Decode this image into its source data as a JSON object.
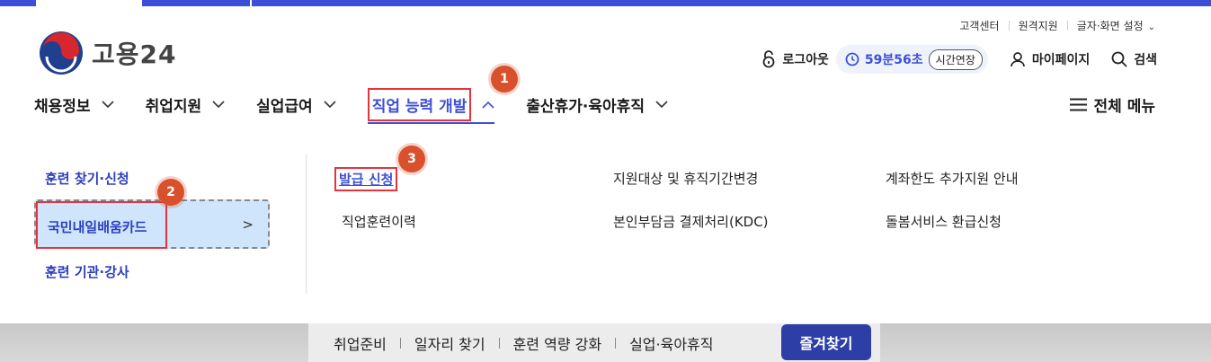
{
  "colors": {
    "brand": "#3d4fd6",
    "highlight_red": "#e5333c",
    "badge": "#d8512c",
    "fav_button": "#2d3fa6"
  },
  "util_links": [
    "고객센터",
    "원격지원",
    "글자·화면 설정"
  ],
  "logo": {
    "name": "고용24"
  },
  "account": {
    "logout": "로그아웃",
    "timer": "59분56초",
    "extend": "시간연장",
    "mypage": "마이페이지",
    "search": "검색"
  },
  "gnb": [
    "채용정보",
    "취업지원",
    "실업급여",
    "직업 능력 개발",
    "출산휴가·육아휴직"
  ],
  "all_menu": "전체 메뉴",
  "sidebar": [
    "훈련 찾기·신청",
    "국민내일배움카드",
    "훈련 기관·강사"
  ],
  "submenu": {
    "col1": [
      "발급 신청",
      "직업훈련이력"
    ],
    "col2": [
      "지원대상 및 휴직기간변경",
      "본인부담금 결제처리(KDC)"
    ],
    "col3": [
      "계좌한도 추가지원 안내",
      "돌봄서비스 환급신청"
    ]
  },
  "badges": [
    "1",
    "2",
    "3"
  ],
  "quick": {
    "items": [
      "취업준비",
      "일자리 찾기",
      "훈련 역량 강화",
      "실업·육아휴직"
    ],
    "fav": "즐겨찾기"
  }
}
